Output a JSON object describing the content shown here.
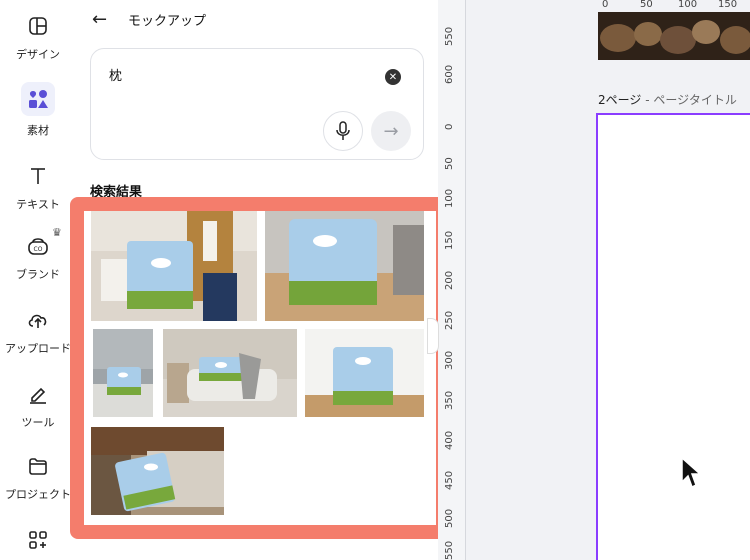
{
  "sidebar": {
    "items": [
      {
        "label": "デザイン",
        "icon": "layout-icon"
      },
      {
        "label": "素材",
        "icon": "shapes-icon",
        "active": true
      },
      {
        "label": "テキスト",
        "icon": "text-icon"
      },
      {
        "label": "ブランド",
        "icon": "brand-icon",
        "badge": "crown-icon"
      },
      {
        "label": "アップロード",
        "icon": "cloud-upload-icon"
      },
      {
        "label": "ツール",
        "icon": "pen-tool-icon"
      },
      {
        "label": "プロジェクト",
        "icon": "folder-icon"
      },
      {
        "label": "",
        "icon": "apps-icon"
      }
    ]
  },
  "panel": {
    "title": "モックアップ",
    "search": {
      "value": "枕",
      "clear_icon": "clear-icon",
      "mic_icon": "mic-icon",
      "submit_icon": "arrow-right-icon"
    },
    "results_heading": "検索結果",
    "results": [
      {
        "name": "pillow-mockup-person-sofa"
      },
      {
        "name": "pillow-mockup-floor-sofa"
      },
      {
        "name": "pillow-mockup-bed-wall"
      },
      {
        "name": "pillow-mockup-white-sofa-room"
      },
      {
        "name": "pillow-mockup-wooden-floor"
      },
      {
        "name": "pillow-mockup-bench-table"
      }
    ],
    "highlight_color": "#f47d6c"
  },
  "canvas": {
    "ruler_ticks_top": [
      "0",
      "50",
      "100",
      "150"
    ],
    "ruler_ticks_left_upper": [
      "550",
      "600"
    ],
    "ruler_ticks_left_lower": [
      "0",
      "50",
      "100",
      "150",
      "200",
      "250",
      "300",
      "350",
      "400",
      "450",
      "500",
      "550"
    ],
    "page_label_number": "2ページ",
    "page_label_sep": " - ",
    "page_label_title": "ページタイトル",
    "selection_color": "#8b3dff"
  }
}
